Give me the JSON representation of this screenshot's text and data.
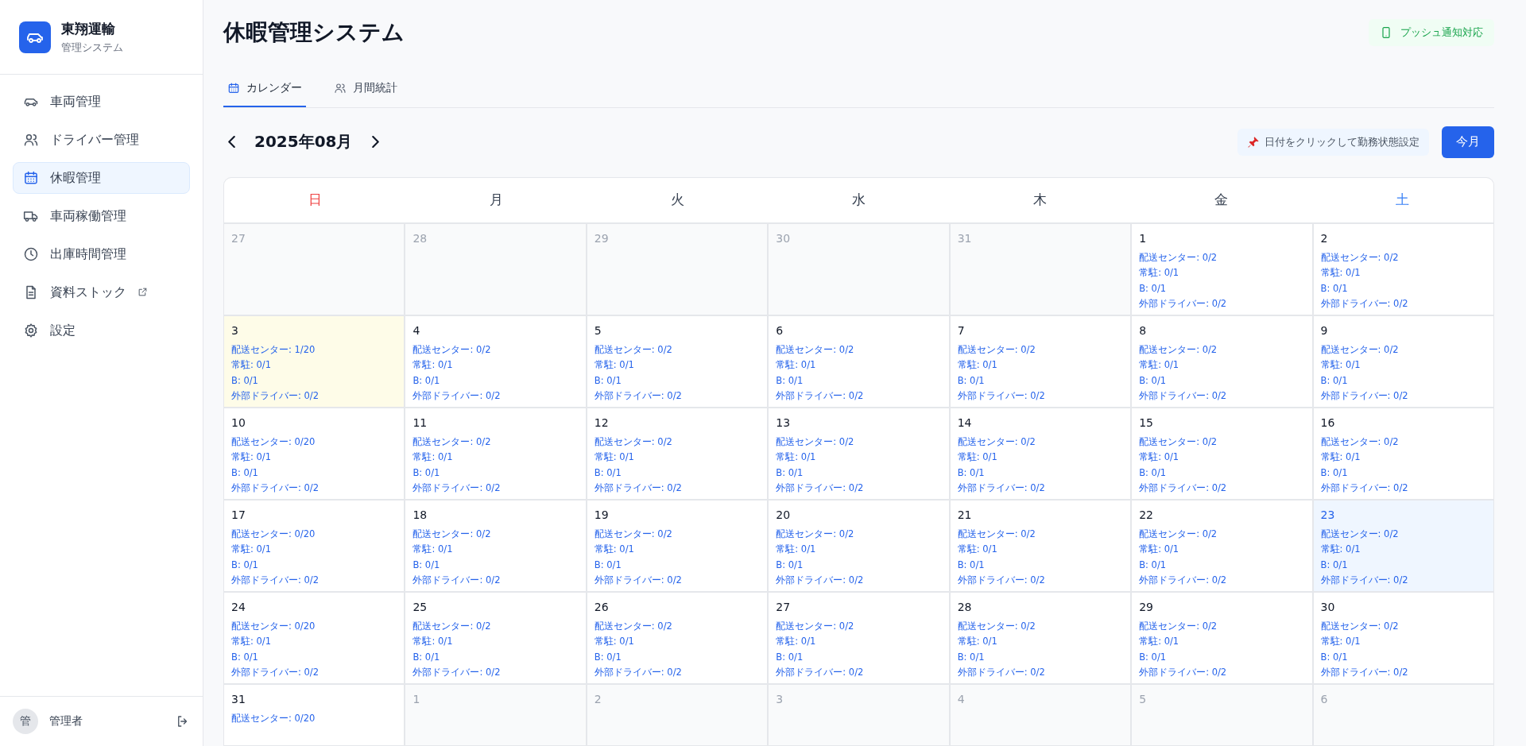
{
  "sidebar": {
    "brand": {
      "name": "東翔運輸",
      "subtitle": "管理システム"
    },
    "items": [
      {
        "label": "車両管理",
        "selected": false,
        "external": false
      },
      {
        "label": "ドライバー管理",
        "selected": false,
        "external": false
      },
      {
        "label": "休暇管理",
        "selected": true,
        "external": false
      },
      {
        "label": "車両稼働管理",
        "selected": false,
        "external": false
      },
      {
        "label": "出庫時間管理",
        "selected": false,
        "external": false
      },
      {
        "label": "資料ストック",
        "selected": false,
        "external": true
      },
      {
        "label": "設定",
        "selected": false,
        "external": false
      }
    ],
    "user": {
      "avatar": "管",
      "name": "管理者"
    }
  },
  "header": {
    "title": "休暇管理システム",
    "badge": "プッシュ通知対応"
  },
  "tabs": [
    {
      "label": "カレンダー",
      "selected": true
    },
    {
      "label": "月間統計",
      "selected": false
    }
  ],
  "calendar": {
    "month": "2025年08月",
    "hint": "日付をクリックして勤務状態設定",
    "today_button": "今月",
    "weekdays": [
      {
        "label": "日",
        "color": "#ef4444"
      },
      {
        "label": "月",
        "color": "#374151"
      },
      {
        "label": "火",
        "color": "#374151"
      },
      {
        "label": "水",
        "color": "#374151"
      },
      {
        "label": "木",
        "color": "#374151"
      },
      {
        "label": "金",
        "color": "#374151"
      },
      {
        "label": "土",
        "color": "#3b82f6"
      }
    ],
    "weeks": [
      [
        {
          "day": "27",
          "kind": "other"
        },
        {
          "day": "28",
          "kind": "other"
        },
        {
          "day": "29",
          "kind": "other"
        },
        {
          "day": "30",
          "kind": "other"
        },
        {
          "day": "31",
          "kind": "other"
        },
        {
          "day": "1",
          "kind": "normal",
          "lines": [
            "配送センター: 0/2",
            "常駐: 0/1",
            "B: 0/1",
            "外部ドライバー: 0/2"
          ]
        },
        {
          "day": "2",
          "kind": "normal",
          "lines": [
            "配送センター: 0/2",
            "常駐: 0/1",
            "B: 0/1",
            "外部ドライバー: 0/2"
          ]
        }
      ],
      [
        {
          "day": "3",
          "kind": "leave",
          "lines": [
            "配送センター: 1/20",
            "常駐: 0/1",
            "B: 0/1",
            "外部ドライバー: 0/2"
          ]
        },
        {
          "day": "4",
          "kind": "normal",
          "lines": [
            "配送センター: 0/2",
            "常駐: 0/1",
            "B: 0/1",
            "外部ドライバー: 0/2"
          ]
        },
        {
          "day": "5",
          "kind": "normal",
          "lines": [
            "配送センター: 0/2",
            "常駐: 0/1",
            "B: 0/1",
            "外部ドライバー: 0/2"
          ]
        },
        {
          "day": "6",
          "kind": "normal",
          "lines": [
            "配送センター: 0/2",
            "常駐: 0/1",
            "B: 0/1",
            "外部ドライバー: 0/2"
          ]
        },
        {
          "day": "7",
          "kind": "normal",
          "lines": [
            "配送センター: 0/2",
            "常駐: 0/1",
            "B: 0/1",
            "外部ドライバー: 0/2"
          ]
        },
        {
          "day": "8",
          "kind": "normal",
          "lines": [
            "配送センター: 0/2",
            "常駐: 0/1",
            "B: 0/1",
            "外部ドライバー: 0/2"
          ]
        },
        {
          "day": "9",
          "kind": "normal",
          "lines": [
            "配送センター: 0/2",
            "常駐: 0/1",
            "B: 0/1",
            "外部ドライバー: 0/2"
          ]
        }
      ],
      [
        {
          "day": "10",
          "kind": "normal",
          "lines": [
            "配送センター: 0/20",
            "常駐: 0/1",
            "B: 0/1",
            "外部ドライバー: 0/2"
          ]
        },
        {
          "day": "11",
          "kind": "normal",
          "lines": [
            "配送センター: 0/2",
            "常駐: 0/1",
            "B: 0/1",
            "外部ドライバー: 0/2"
          ]
        },
        {
          "day": "12",
          "kind": "normal",
          "lines": [
            "配送センター: 0/2",
            "常駐: 0/1",
            "B: 0/1",
            "外部ドライバー: 0/2"
          ]
        },
        {
          "day": "13",
          "kind": "normal",
          "lines": [
            "配送センター: 0/2",
            "常駐: 0/1",
            "B: 0/1",
            "外部ドライバー: 0/2"
          ]
        },
        {
          "day": "14",
          "kind": "normal",
          "lines": [
            "配送センター: 0/2",
            "常駐: 0/1",
            "B: 0/1",
            "外部ドライバー: 0/2"
          ]
        },
        {
          "day": "15",
          "kind": "normal",
          "lines": [
            "配送センター: 0/2",
            "常駐: 0/1",
            "B: 0/1",
            "外部ドライバー: 0/2"
          ]
        },
        {
          "day": "16",
          "kind": "normal",
          "lines": [
            "配送センター: 0/2",
            "常駐: 0/1",
            "B: 0/1",
            "外部ドライバー: 0/2"
          ]
        }
      ],
      [
        {
          "day": "17",
          "kind": "normal",
          "lines": [
            "配送センター: 0/20",
            "常駐: 0/1",
            "B: 0/1",
            "外部ドライバー: 0/2"
          ]
        },
        {
          "day": "18",
          "kind": "normal",
          "lines": [
            "配送センター: 0/2",
            "常駐: 0/1",
            "B: 0/1",
            "外部ドライバー: 0/2"
          ]
        },
        {
          "day": "19",
          "kind": "normal",
          "lines": [
            "配送センター: 0/2",
            "常駐: 0/1",
            "B: 0/1",
            "外部ドライバー: 0/2"
          ]
        },
        {
          "day": "20",
          "kind": "normal",
          "lines": [
            "配送センター: 0/2",
            "常駐: 0/1",
            "B: 0/1",
            "外部ドライバー: 0/2"
          ]
        },
        {
          "day": "21",
          "kind": "normal",
          "lines": [
            "配送センター: 0/2",
            "常駐: 0/1",
            "B: 0/1",
            "外部ドライバー: 0/2"
          ]
        },
        {
          "day": "22",
          "kind": "normal",
          "lines": [
            "配送センター: 0/2",
            "常駐: 0/1",
            "B: 0/1",
            "外部ドライバー: 0/2"
          ]
        },
        {
          "day": "23",
          "kind": "today",
          "lines": [
            "配送センター: 0/2",
            "常駐: 0/1",
            "B: 0/1",
            "外部ドライバー: 0/2"
          ]
        }
      ],
      [
        {
          "day": "24",
          "kind": "normal",
          "lines": [
            "配送センター: 0/20",
            "常駐: 0/1",
            "B: 0/1",
            "外部ドライバー: 0/2"
          ]
        },
        {
          "day": "25",
          "kind": "normal",
          "lines": [
            "配送センター: 0/2",
            "常駐: 0/1",
            "B: 0/1",
            "外部ドライバー: 0/2"
          ]
        },
        {
          "day": "26",
          "kind": "normal",
          "lines": [
            "配送センター: 0/2",
            "常駐: 0/1",
            "B: 0/1",
            "外部ドライバー: 0/2"
          ]
        },
        {
          "day": "27",
          "kind": "normal",
          "lines": [
            "配送センター: 0/2",
            "常駐: 0/1",
            "B: 0/1",
            "外部ドライバー: 0/2"
          ]
        },
        {
          "day": "28",
          "kind": "normal",
          "lines": [
            "配送センター: 0/2",
            "常駐: 0/1",
            "B: 0/1",
            "外部ドライバー: 0/2"
          ]
        },
        {
          "day": "29",
          "kind": "normal",
          "lines": [
            "配送センター: 0/2",
            "常駐: 0/1",
            "B: 0/1",
            "外部ドライバー: 0/2"
          ]
        },
        {
          "day": "30",
          "kind": "normal",
          "lines": [
            "配送センター: 0/2",
            "常駐: 0/1",
            "B: 0/1",
            "外部ドライバー: 0/2"
          ]
        }
      ],
      [
        {
          "day": "31",
          "kind": "normal",
          "lines": [
            "配送センター: 0/20"
          ]
        },
        {
          "day": "1",
          "kind": "other"
        },
        {
          "day": "2",
          "kind": "other"
        },
        {
          "day": "3",
          "kind": "other"
        },
        {
          "day": "4",
          "kind": "other"
        },
        {
          "day": "5",
          "kind": "other"
        },
        {
          "day": "6",
          "kind": "other"
        }
      ]
    ]
  }
}
